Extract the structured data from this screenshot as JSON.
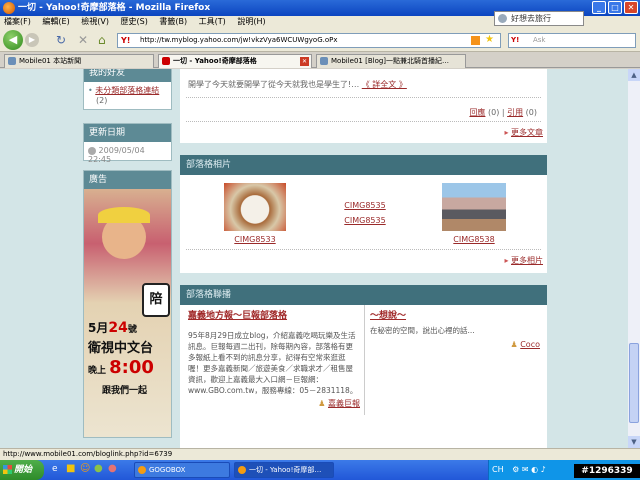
{
  "window": {
    "title": "一切 - Yahoo!奇摩部落格 - Mozilla Firefox",
    "login_label": "好想去旅行"
  },
  "menu": [
    "檔案(F)",
    "編輯(E)",
    "檢視(V)",
    "歷史(S)",
    "書籤(B)",
    "工具(T)",
    "說明(H)"
  ],
  "nav": {
    "url": "http://tw.myblog.yahoo.com/jw!vkzVya6WCUWgyoG.oPx",
    "search_placeholder": "Ask",
    "search_engine": "Y!"
  },
  "tabs": [
    {
      "label": "Mobile01 本站新聞",
      "active": false
    },
    {
      "label": "一切 - Yahoo!奇摩部落格",
      "active": true
    },
    {
      "label": "Mobile01 [Blog]一點兼北騎首播紀…",
      "active": false
    }
  ],
  "sidebar": {
    "top_partial_label": "我的好友",
    "top_link": "未分類部落格連結",
    "top_count": "(2)",
    "update_title": "更新日期",
    "update_date": "2009/05/04 22:45",
    "ad_title": "廣告",
    "ad": {
      "date_prefix": "5月",
      "date_number": "24",
      "date_suffix": "號",
      "channel": "衛視中文台",
      "time_prefix": "晚上",
      "time": "8:00",
      "cta": "跟我們一起",
      "badge": "陪"
    }
  },
  "post": {
    "excerpt": "開學了今天就要開學了從今天就我也是學生了!…",
    "read_more": "《 詳全文 》",
    "reply_label": "回應",
    "reply_count": "(0)",
    "cite_label": "引用",
    "cite_count": "(0)",
    "more_articles": "更多文章"
  },
  "photos": {
    "title": "部落格相片",
    "items": [
      {
        "caption": "CIMG8533"
      },
      {
        "caption": "CIMG8535"
      },
      {
        "caption": "CIMG8535"
      },
      {
        "caption": "CIMG8538"
      }
    ],
    "more": "更多相片"
  },
  "links": {
    "title": "部落格聯播",
    "left": {
      "title": "嘉義地方報～巨報部落格",
      "body": "95年8月29日成立blog，介紹嘉義吃喝玩樂及生活訊息。巨報每週二出刊，除每期內容，部落格有更多報紙上看不到的訊息分享，記得有空常來逛逛喔！更多嘉義新聞／旅遊美食／求職求才／租售屋資訊，歡迎上嘉義最大入口網－巨報網：www.GBO.com.tw，服務專線：05－2831118。",
      "author": "嘉義巨報"
    },
    "right": {
      "title": "～想說～",
      "body": "在秘密的空間，說出心裡的話...",
      "author": "Coco"
    }
  },
  "status": {
    "text": "http://www.mobile01.com/bloglink.php?id=6739"
  },
  "taskbar": {
    "start": "開始",
    "tasks": [
      {
        "label": "GOGOBOX",
        "active": false
      },
      {
        "label": "一切 - Yahoo!奇摩部…",
        "active": true
      }
    ],
    "lang": "CH",
    "watermark": "#1296339"
  }
}
